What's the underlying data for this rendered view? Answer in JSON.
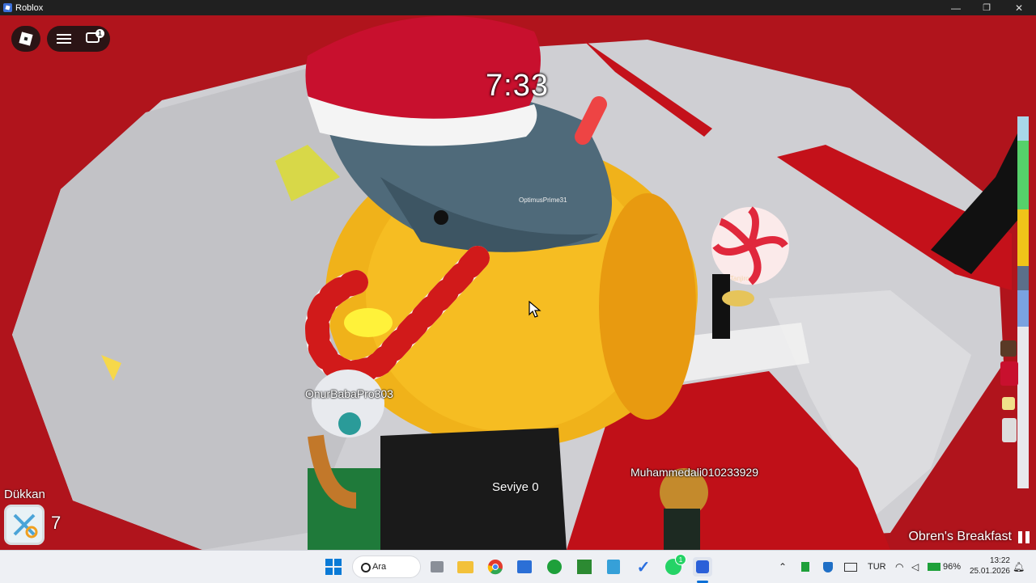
{
  "window": {
    "title": "Roblox",
    "minimize": "—",
    "maximize": "❐",
    "close": "✕"
  },
  "hud": {
    "roblox_menu_icon": "roblox-logo-icon",
    "menu_icon": "hamburger-menu-icon",
    "chat_icon": "chat-icon",
    "chat_badge": "1",
    "timer": "7:33",
    "level_text": "Seviye 0",
    "shop_label": "Dükkan",
    "shop_count": "7",
    "now_playing": "Obren's Breakfast",
    "progress_colors": [
      "#a8d6e8",
      "#55d16a",
      "#f0c419",
      "#5b6f8a",
      "#7aa2e0",
      "#c5c8d4"
    ]
  },
  "players": [
    {
      "name": "OptimusPrime31",
      "style": "small"
    },
    {
      "name": "Tanjiro",
      "style": "small"
    },
    {
      "name": "OnurBabaPro303",
      "style": "normal"
    },
    {
      "name": "Muhammedali010233929",
      "style": "normal"
    }
  ],
  "taskbar": {
    "search_label": "Ara",
    "apps": [
      "start-icon",
      "search-icon",
      "task-view-icon",
      "file-explorer-icon",
      "chrome-icon",
      "store-icon",
      "xbox-icon",
      "minecraft-icon",
      "notepad-icon",
      "todo-icon",
      "whatsapp-icon",
      "roblox-taskbar-icon"
    ],
    "whatsapp_badge": "1",
    "language": "TUR",
    "battery": "96%",
    "time": "13:22",
    "date": "25.01.2026"
  }
}
